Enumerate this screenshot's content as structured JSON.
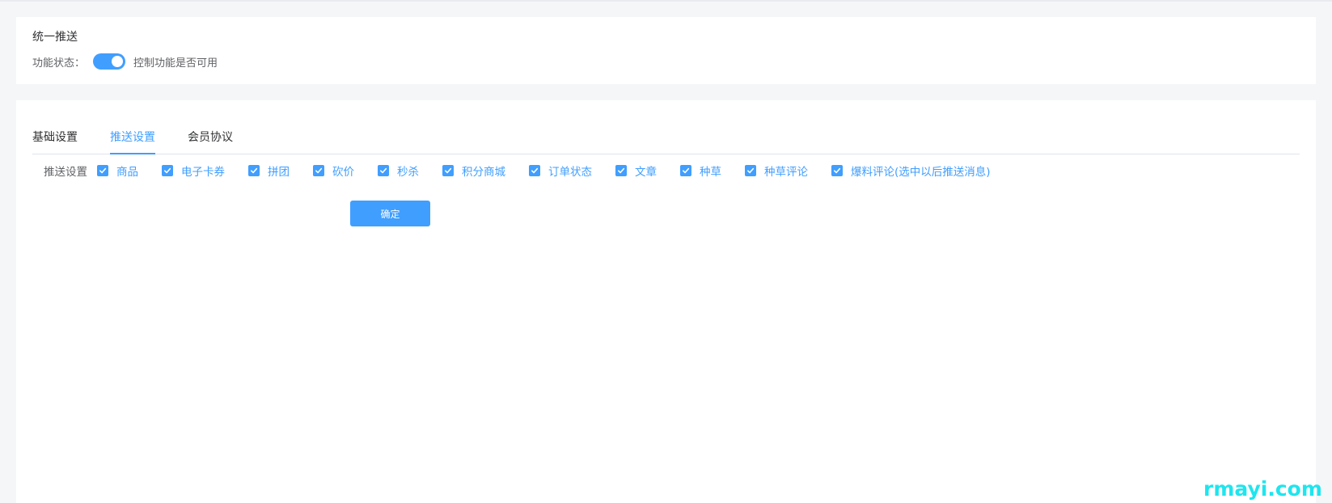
{
  "header_card": {
    "title": "统一推送",
    "status_label": "功能状态：",
    "switch_on": true,
    "status_desc": "控制功能是否可用"
  },
  "tabs": [
    {
      "label": "基础设置",
      "active": false
    },
    {
      "label": "推送设置",
      "active": true
    },
    {
      "label": "会员协议",
      "active": false
    }
  ],
  "push_settings": {
    "label": "推送设置",
    "options": [
      {
        "label": "商品",
        "checked": true
      },
      {
        "label": "电子卡券",
        "checked": true
      },
      {
        "label": "拼团",
        "checked": true
      },
      {
        "label": "砍价",
        "checked": true
      },
      {
        "label": "秒杀",
        "checked": true
      },
      {
        "label": "积分商城",
        "checked": true
      },
      {
        "label": "订单状态",
        "checked": true
      },
      {
        "label": "文章",
        "checked": true
      },
      {
        "label": "种草",
        "checked": true
      },
      {
        "label": "种草评论",
        "checked": true
      },
      {
        "label": "爆料评论(选中以后推送消息)",
        "checked": true
      }
    ]
  },
  "confirm_label": "确定",
  "watermark": "rmayi.com",
  "colors": {
    "accent": "#409eff",
    "background": "#f5f6f8",
    "watermark": "#1fe5ee"
  }
}
